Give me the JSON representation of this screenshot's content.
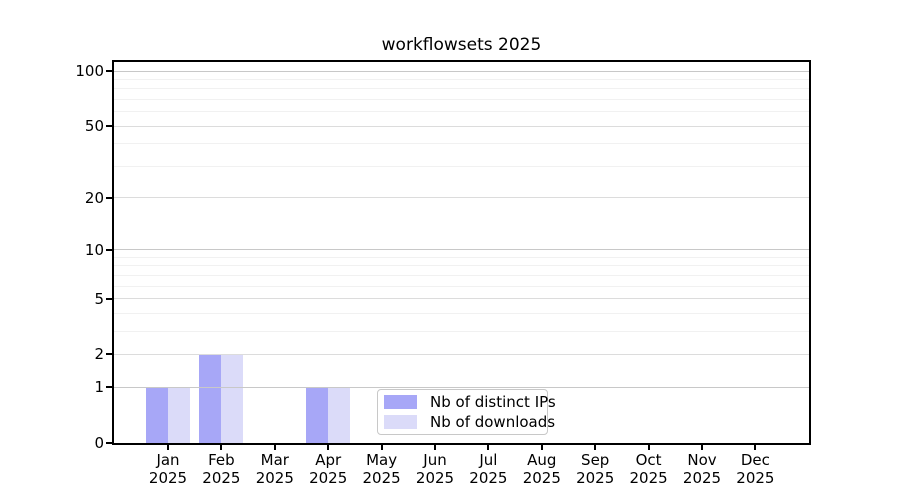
{
  "title": "workflowsets 2025",
  "chart_data": {
    "type": "bar",
    "title": "workflowsets 2025",
    "x_categories": [
      "Jan",
      "Feb",
      "Mar",
      "Apr",
      "May",
      "Jun",
      "Jul",
      "Aug",
      "Sep",
      "Oct",
      "Nov",
      "Dec"
    ],
    "x_year": "2025",
    "series": [
      {
        "name": "Nb of distinct IPs",
        "color": "#a7a7f7",
        "values": [
          1,
          2,
          0,
          1,
          0,
          0,
          0,
          0,
          0,
          0,
          0,
          0
        ]
      },
      {
        "name": "Nb of downloads",
        "color": "#dbdbf9",
        "values": [
          1,
          2,
          0,
          1,
          0,
          0,
          0,
          0,
          0,
          0,
          0,
          0
        ]
      }
    ],
    "yticks": [
      0,
      1,
      2,
      5,
      10,
      20,
      50,
      100
    ],
    "minor_yticks": [
      3,
      4,
      6,
      7,
      8,
      9,
      30,
      40,
      60,
      70,
      80,
      90
    ],
    "scale": "log1p",
    "ylim": [
      0,
      112
    ],
    "grid": true,
    "legend_position": "bottom-center-inside"
  },
  "colors": {
    "axis": "#000000",
    "decade_gridline": "#c8c8c8",
    "major_gridline": "#dcdcdc",
    "minor_gridline": "#f1f1f1",
    "legend_border": "#c8c8c8",
    "text": "#000000"
  }
}
